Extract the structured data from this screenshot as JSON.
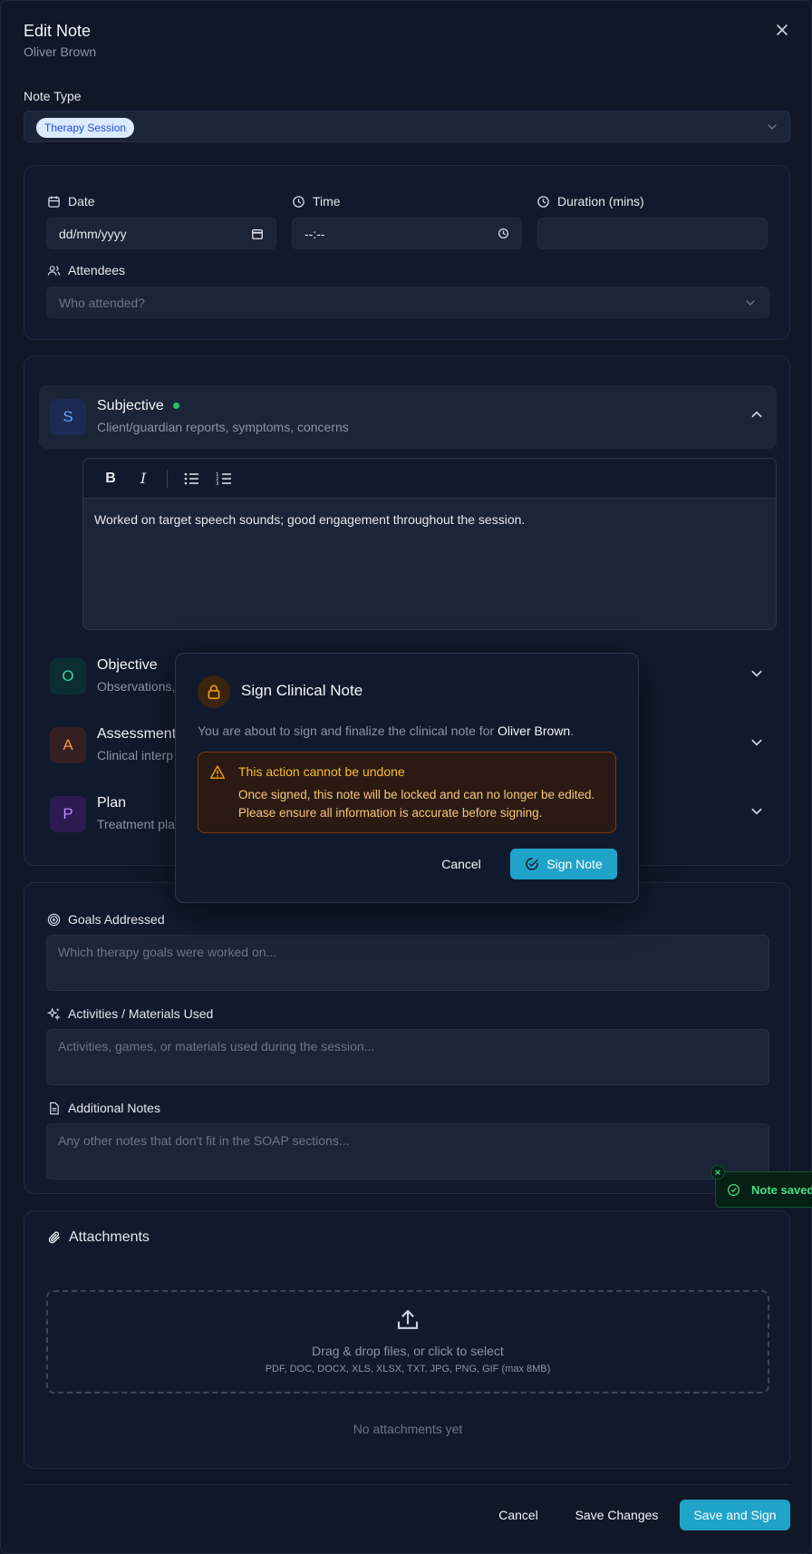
{
  "header": {
    "title": "Edit Note",
    "subtitle": "Oliver Brown"
  },
  "note_type": {
    "label": "Note Type",
    "value": "Therapy Session"
  },
  "session": {
    "date_label": "Date",
    "date_placeholder": "dd/mm/yyyy",
    "time_label": "Time",
    "time_placeholder": "--:--",
    "duration_label": "Duration (mins)",
    "duration_value": "",
    "attendees_label": "Attendees",
    "attendees_placeholder": "Who attended?"
  },
  "soap": [
    {
      "letter": "S",
      "title": "Subjective",
      "desc": "Client/guardian reports, symptoms, concerns",
      "status_dot_color": "#22c55e"
    },
    {
      "letter": "O",
      "title": "Objective",
      "desc": "Observations,"
    },
    {
      "letter": "A",
      "title": "Assessment",
      "desc": "Clinical interp"
    },
    {
      "letter": "P",
      "title": "Plan",
      "desc": "Treatment pla"
    }
  ],
  "editor": {
    "content": "Worked on target speech sounds; good engagement throughout the session."
  },
  "details": {
    "goals_label": "Goals Addressed",
    "goals_placeholder": "Which therapy goals were worked on...",
    "activities_label": "Activities / Materials Used",
    "activities_placeholder": "Activities, games, or materials used during the session...",
    "notes_label": "Additional Notes",
    "notes_placeholder": "Any other notes that don't fit in the SOAP sections..."
  },
  "attachments": {
    "title": "Attachments",
    "drop_text": "Drag & drop files, or click to select",
    "formats": "PDF, DOC, DOCX, XLS, XLSX, TXT, JPG, PNG, GIF (max 8MB)",
    "empty": "No attachments yet"
  },
  "footer": {
    "cancel": "Cancel",
    "save": "Save Changes",
    "save_sign": "Save and Sign"
  },
  "modal": {
    "title": "Sign Clinical Note",
    "body_prefix": "You are about to sign and finalize the clinical note for",
    "patient": "Oliver Brown",
    "body_suffix": ".",
    "warning_title": "This action cannot be undone",
    "warning_body": "Once signed, this note will be locked and can no longer be edited. Please ensure all information is accurate before signing.",
    "cancel": "Cancel",
    "confirm": "Sign Note"
  },
  "toast": {
    "text": "Note saved"
  },
  "colors": {
    "accent": "#1fa3c9",
    "background": "#101828",
    "warning": "#f59e0b",
    "success": "#22c55e"
  }
}
